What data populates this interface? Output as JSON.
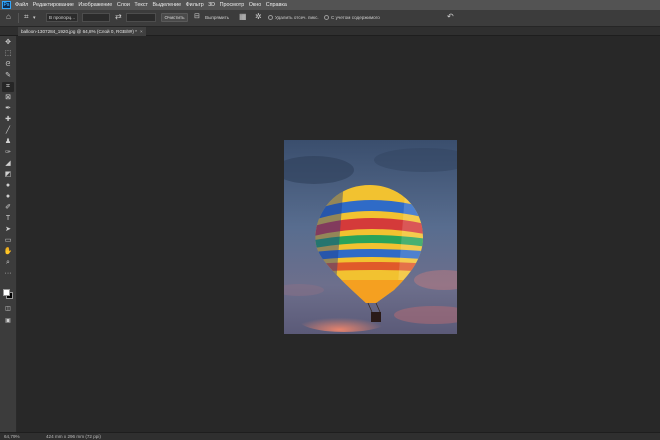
{
  "app": {
    "logo_text": "Ps"
  },
  "menu": [
    "Файл",
    "Редактирование",
    "Изображение",
    "Слои",
    "Текст",
    "Выделение",
    "Фильтр",
    "3D",
    "Просмотр",
    "Окно",
    "Справка"
  ],
  "options": {
    "ratio_select": "В пропорц...",
    "clear_button": "Очистить",
    "straighten_button": "Выпрямить",
    "delete_cropped_label": "Удалить отсеч. пикс.",
    "content_aware_label": "С учетом содержимого"
  },
  "document": {
    "tab_title": "balloon-1307284_1920.jpg @ 64,8% (Слой 0, RGB/8#) *",
    "close_symbol": "×"
  },
  "tools": [
    {
      "icon": "move-icon",
      "glyph": "✥"
    },
    {
      "icon": "marquee-icon",
      "glyph": "⬚"
    },
    {
      "icon": "lasso-icon",
      "glyph": "ᘓ"
    },
    {
      "icon": "quick-select-icon",
      "glyph": "✎"
    },
    {
      "icon": "crop-icon",
      "glyph": "⌗"
    },
    {
      "icon": "frame-icon",
      "glyph": "⊠"
    },
    {
      "icon": "eyedropper-icon",
      "glyph": "✒"
    },
    {
      "icon": "healing-icon",
      "glyph": "✚"
    },
    {
      "icon": "brush-icon",
      "glyph": "╱"
    },
    {
      "icon": "stamp-icon",
      "glyph": "♟"
    },
    {
      "icon": "history-brush-icon",
      "glyph": "✑"
    },
    {
      "icon": "eraser-icon",
      "glyph": "◢"
    },
    {
      "icon": "gradient-icon",
      "glyph": "◩"
    },
    {
      "icon": "blur-icon",
      "glyph": "●"
    },
    {
      "icon": "dodge-icon",
      "glyph": "●"
    },
    {
      "icon": "pen-icon",
      "glyph": "✐"
    },
    {
      "icon": "type-icon",
      "glyph": "T"
    },
    {
      "icon": "path-select-icon",
      "glyph": "➤"
    },
    {
      "icon": "shape-icon",
      "glyph": "▭"
    },
    {
      "icon": "hand-icon",
      "glyph": "✋"
    },
    {
      "icon": "zoom-icon",
      "glyph": "⌕"
    },
    {
      "icon": "more-tools-icon",
      "glyph": "···"
    }
  ],
  "colors": {
    "foreground": "#ffffff",
    "background": "#000000",
    "accent": "#31a8ff"
  },
  "status": {
    "zoom": "64,79%",
    "doc_info": "424 mm x 296 mm (72 ppi)"
  }
}
